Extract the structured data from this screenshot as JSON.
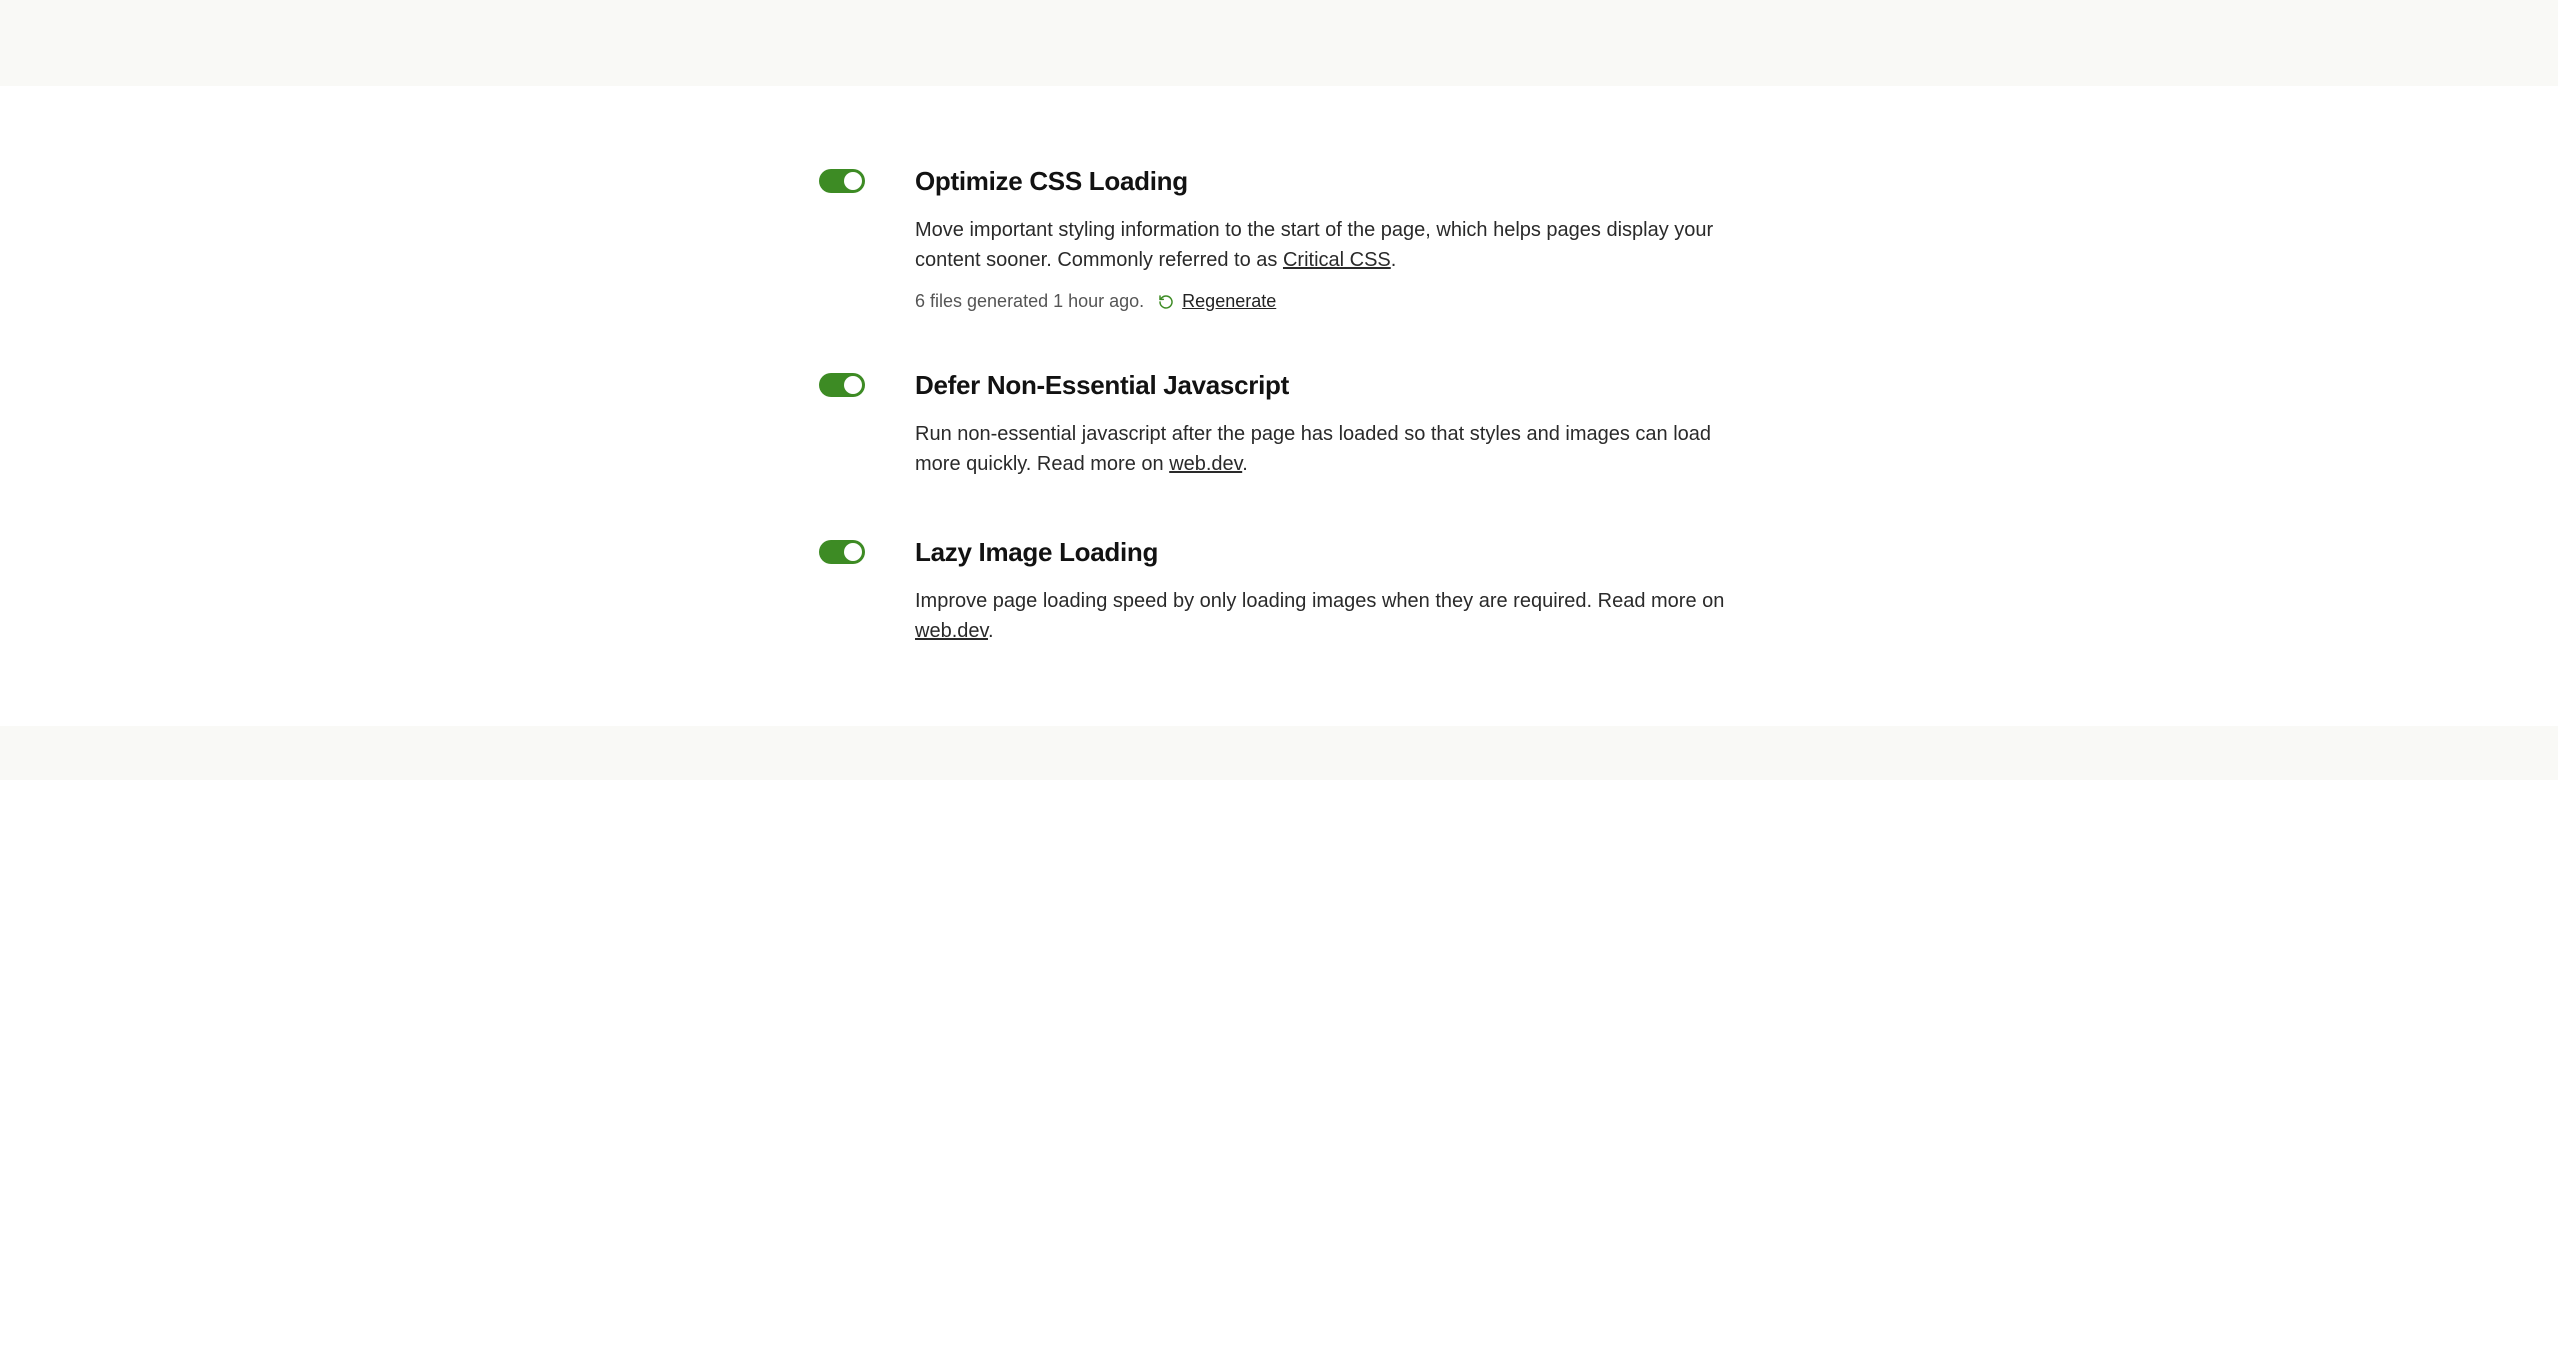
{
  "settings": [
    {
      "title": "Optimize CSS Loading",
      "desc_prefix": "Move important styling information to the start of the page, which helps pages display your content sooner. Commonly referred to as ",
      "link_text": "Critical CSS",
      "desc_suffix": ".",
      "enabled": true,
      "status_text": "6 files generated 1 hour ago.",
      "regenerate_label": "Regenerate"
    },
    {
      "title": "Defer Non-Essential Javascript",
      "desc_prefix": "Run non-essential javascript after the page has loaded so that styles and images can load more quickly. Read more on ",
      "link_text": "web.dev",
      "desc_suffix": ".",
      "enabled": true
    },
    {
      "title": "Lazy Image Loading",
      "desc_prefix": "Improve page loading speed by only loading images when they are required. Read more on ",
      "link_text": "web.dev",
      "desc_suffix": ".",
      "enabled": true
    }
  ]
}
